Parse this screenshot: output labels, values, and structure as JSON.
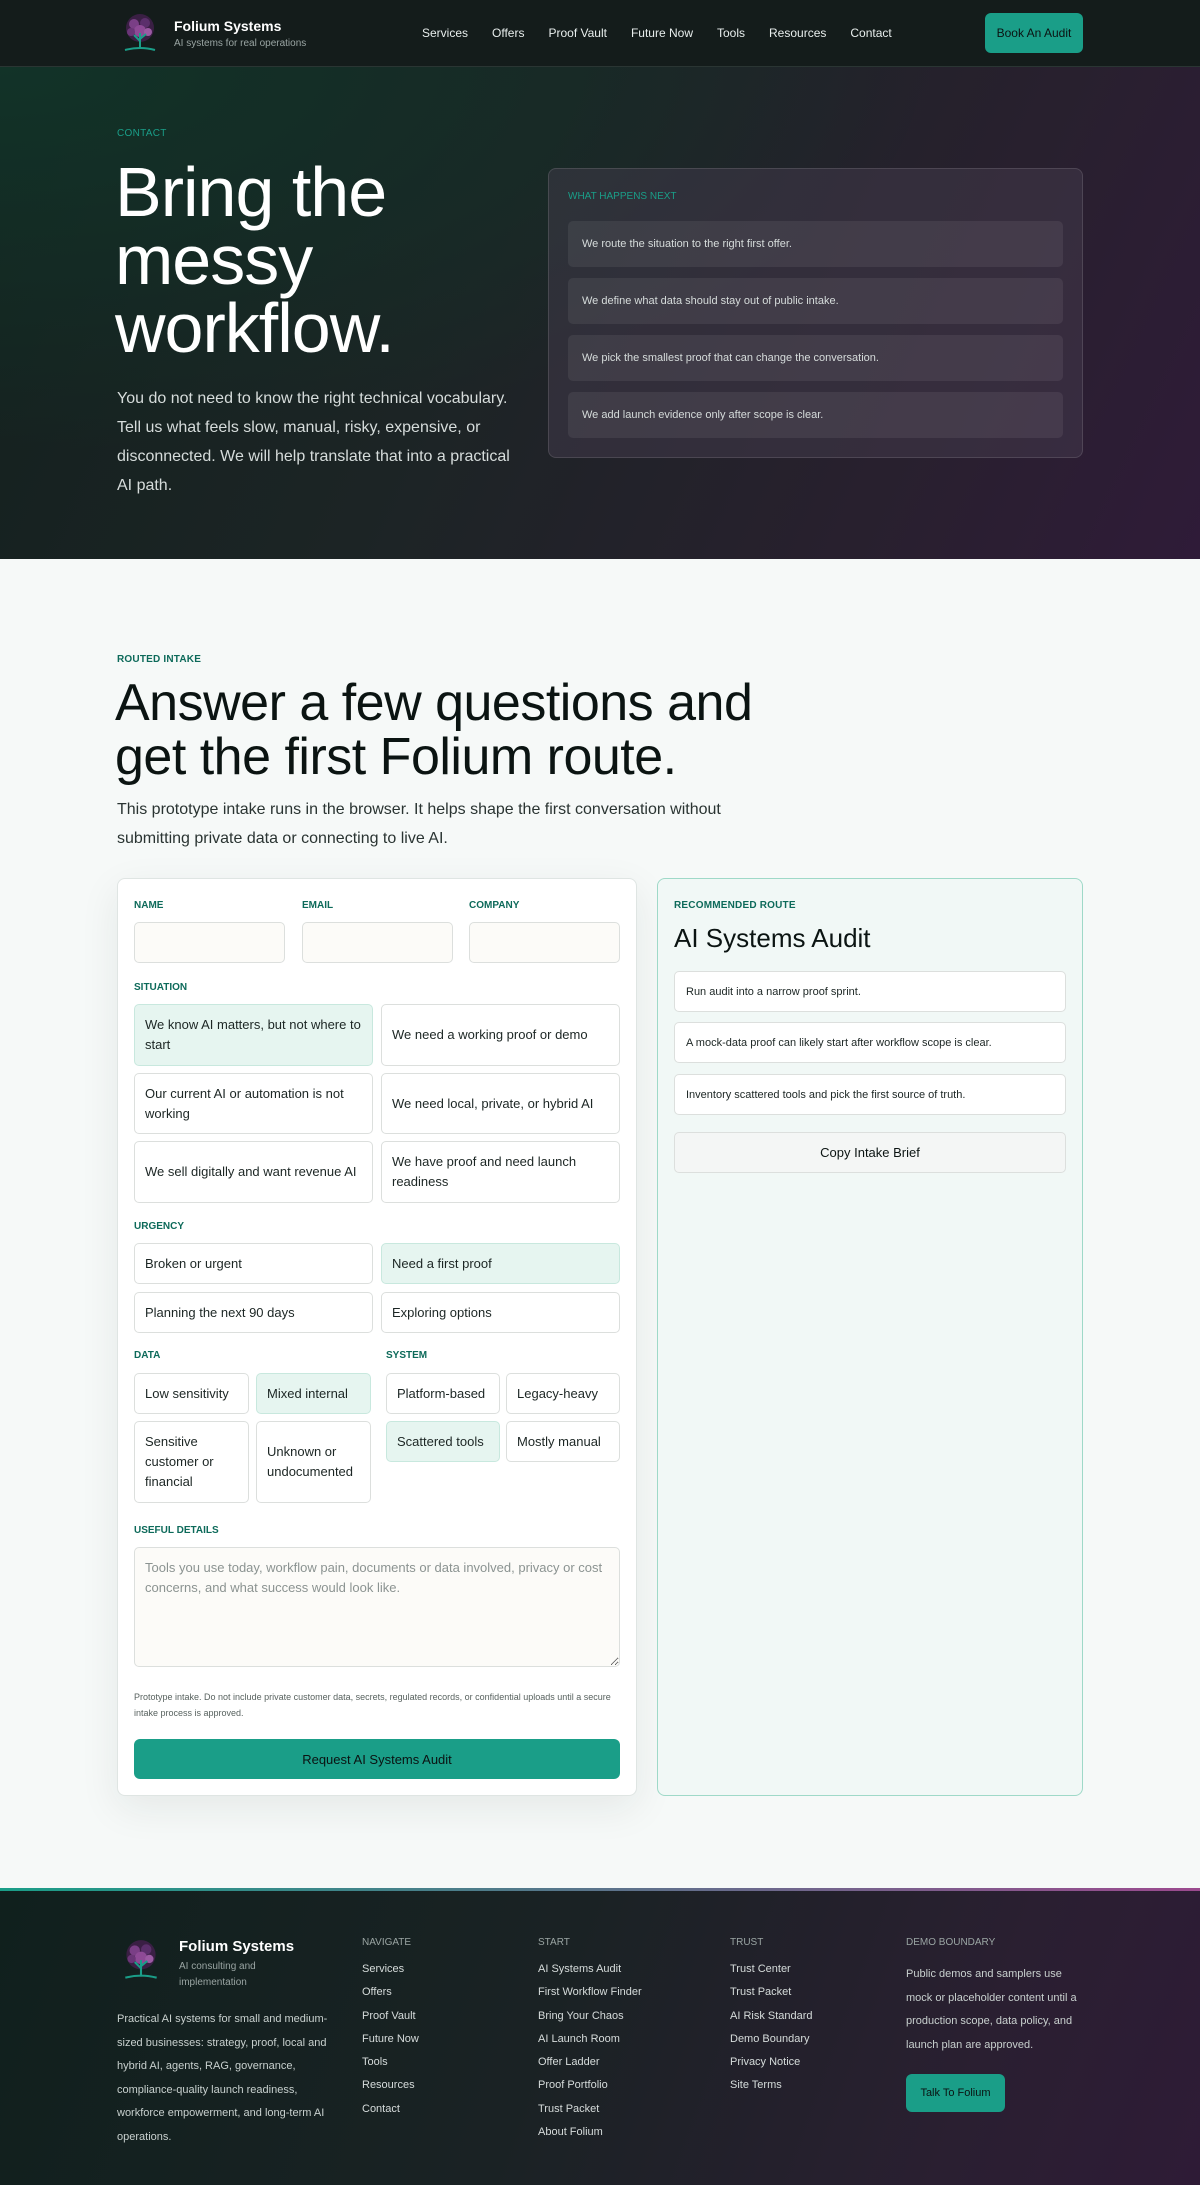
{
  "nav": {
    "brand": "Folium Systems",
    "tagline": "AI systems for real operations",
    "links": [
      "Services",
      "Offers",
      "Proof Vault",
      "Future Now",
      "Tools",
      "Resources",
      "Contact"
    ],
    "cta": "Book An Audit"
  },
  "hero": {
    "eyebrow": "CONTACT",
    "title": "Bring the messy workflow.",
    "body": "You do not need to know the right technical vocabulary. Tell us what feels slow, manual, risky, expensive, or disconnected. We will help translate that into a practical AI path.",
    "card_eyebrow": "WHAT HAPPENS NEXT",
    "steps": [
      "We route the situation to the right first offer.",
      "We define what data should stay out of public intake.",
      "We pick the smallest proof that can change the conversation.",
      "We add launch evidence only after scope is clear."
    ]
  },
  "intake": {
    "eyebrow": "ROUTED INTAKE",
    "title": "Answer a few questions and get the first Folium route.",
    "body": "This prototype intake runs in the browser. It helps shape the first conversation without submitting private data or connecting to live AI.",
    "form": {
      "name_label": "NAME",
      "email_label": "EMAIL",
      "company_label": "COMPANY",
      "name_value": "",
      "email_value": "",
      "company_value": "",
      "situation_label": "SITUATION",
      "situation": [
        "We know AI matters, but not where to start",
        "We need a working proof or demo",
        "Our current AI or automation is not working",
        "We need local, private, or hybrid AI",
        "We sell digitally and want revenue AI",
        "We have proof and need launch readiness"
      ],
      "urgency_label": "URGENCY",
      "urgency": [
        "Broken or urgent",
        "Need a first proof",
        "Planning the next 90 days",
        "Exploring options"
      ],
      "data_label": "DATA",
      "data": [
        "Low sensitivity",
        "Mixed internal",
        "Sensitive customer or financial",
        "Unknown or undocumented"
      ],
      "system_label": "SYSTEM",
      "system": [
        "Platform-based",
        "Legacy-heavy",
        "Scattered tools",
        "Mostly manual"
      ],
      "details_label": "USEFUL DETAILS",
      "details_placeholder": "Tools you use today, workflow pain, documents or data involved, privacy or cost concerns, and what success would look like.",
      "note": "Prototype intake. Do not include private customer data, secrets, regulated records, or confidential uploads until a secure intake process is approved.",
      "submit": "Request AI Systems Audit"
    },
    "route": {
      "eyebrow": "RECOMMENDED ROUTE",
      "title": "AI Systems Audit",
      "items": [
        "Run audit into a narrow proof sprint.",
        "A mock-data proof can likely start after workflow scope is clear.",
        "Inventory scattered tools and pick the first source of truth."
      ],
      "copy": "Copy Intake Brief"
    }
  },
  "footer": {
    "brand": "Folium Systems",
    "tagline": "AI consulting and implementation",
    "description": "Practical AI systems for small and medium-sized businesses: strategy, proof, local and hybrid AI, agents, RAG, governance, compliance-quality launch readiness, workforce empowerment, and long-term AI operations.",
    "navigate_title": "NAVIGATE",
    "navigate": [
      "Services",
      "Offers",
      "Proof Vault",
      "Future Now",
      "Tools",
      "Resources",
      "Contact"
    ],
    "start_title": "START",
    "start": [
      "AI Systems Audit",
      "First Workflow Finder",
      "Bring Your Chaos",
      "AI Launch Room",
      "Offer Ladder",
      "Proof Portfolio",
      "Trust Packet",
      "About Folium"
    ],
    "trust_title": "TRUST",
    "trust": [
      "Trust Center",
      "Trust Packet",
      "AI Risk Standard",
      "Demo Boundary",
      "Privacy Notice",
      "Site Terms"
    ],
    "demo_title": "DEMO BOUNDARY",
    "demo_text": "Public demos and samplers use mock or placeholder content until a production scope, data policy, and launch plan are approved.",
    "demo_cta": "Talk To Folium"
  },
  "colors": {
    "accent": "#1a9e88",
    "accent_text": "#0d6a5a",
    "selected_bg": "#e6f5f0",
    "dark_bg": "#141c1b"
  },
  "selected": {
    "situation": 0,
    "urgency": 1,
    "data": 1,
    "system": 2
  }
}
